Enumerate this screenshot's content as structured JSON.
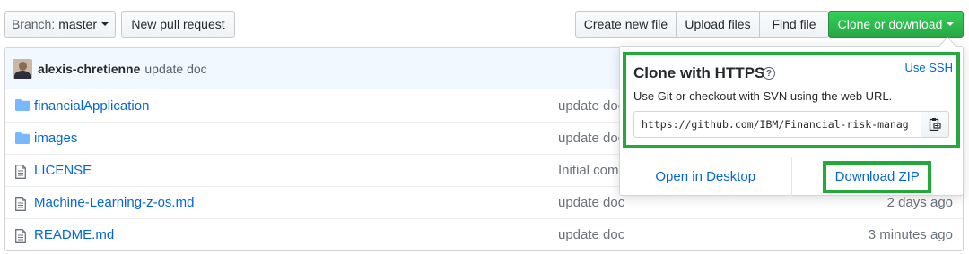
{
  "toolbar": {
    "branch_prefix": "Branch:",
    "branch_name": "master",
    "new_pr_label": "New pull request",
    "create_file_label": "Create new file",
    "upload_files_label": "Upload files",
    "find_file_label": "Find file",
    "clone_label": "Clone or download"
  },
  "commit": {
    "author": "alexis-chretienne",
    "message": "update doc"
  },
  "files": [
    {
      "type": "folder",
      "icon": "folder-icon",
      "name": "financialApplication",
      "message": "update doc",
      "age": ""
    },
    {
      "type": "folder",
      "icon": "folder-icon",
      "name": "images",
      "message": "update doc",
      "age": ""
    },
    {
      "type": "file",
      "icon": "file-icon",
      "name": "LICENSE",
      "message": "Initial com",
      "age": ""
    },
    {
      "type": "file",
      "icon": "file-icon",
      "name": "Machine-Learning-z-os.md",
      "message": "update doc",
      "age": "2 days ago"
    },
    {
      "type": "file",
      "icon": "file-icon",
      "name": "README.md",
      "message": "update doc",
      "age": "3 minutes ago"
    }
  ],
  "clone_popover": {
    "title": "Clone with HTTPS",
    "use_ssh": "Use SSH",
    "description": "Use Git or checkout with SVN using the web URL.",
    "url": "https://github.com/IBM/Financial-risk-manag",
    "open_desktop": "Open in Desktop",
    "download_zip": "Download ZIP"
  },
  "colors": {
    "accent_green": "#28a745",
    "highlight_box": "#22a93a",
    "link_blue": "#0366d6"
  }
}
